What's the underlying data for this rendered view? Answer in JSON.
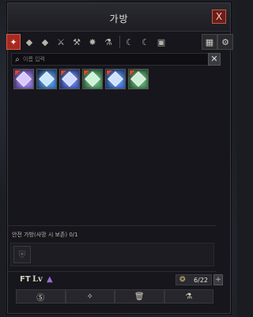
{
  "window": {
    "title": "가방",
    "close_label": "X"
  },
  "tabs": [
    {
      "name": "tab-all",
      "glyph": "✦",
      "active": true
    },
    {
      "name": "tab-equipment",
      "glyph": "◆",
      "active": false
    },
    {
      "name": "tab-accessory",
      "glyph": "◆",
      "active": false
    },
    {
      "name": "tab-weapon",
      "glyph": "⚔",
      "active": false
    },
    {
      "name": "tab-craft",
      "glyph": "⚒",
      "active": false
    },
    {
      "name": "tab-material",
      "glyph": "✸",
      "active": false
    },
    {
      "name": "tab-potion",
      "glyph": "⚗",
      "active": false
    },
    {
      "name": "tab-moon-1",
      "glyph": "☾",
      "active": false
    },
    {
      "name": "tab-moon-2",
      "glyph": "☾",
      "active": false
    },
    {
      "name": "tab-misc",
      "glyph": "▣",
      "active": false
    }
  ],
  "tab_right": [
    {
      "name": "grid-view-icon",
      "glyph": "▦"
    },
    {
      "name": "sort-icon",
      "glyph": "⚙"
    }
  ],
  "search": {
    "placeholder": "이름 입력",
    "value": "",
    "clear_label": "✕"
  },
  "items": [
    {
      "color_a": "#3b1e6b",
      "color_b": "#a68bff",
      "gem": "#d7c8ff",
      "new": true
    },
    {
      "color_a": "#16325e",
      "color_b": "#4ea0ff",
      "gem": "#cbe6ff",
      "new": false
    },
    {
      "color_a": "#1a2c63",
      "color_b": "#5b7dff",
      "gem": "#d0dbff",
      "new": true
    },
    {
      "color_a": "#1e4a2a",
      "color_b": "#5ec27a",
      "gem": "#cdf2d8",
      "new": true
    },
    {
      "color_a": "#17356a",
      "color_b": "#4f8dff",
      "gem": "#cfe1ff",
      "new": true
    },
    {
      "color_a": "#1d4a28",
      "color_b": "#59b56f",
      "gem": "#cdeed5",
      "new": true
    }
  ],
  "safe_bag": {
    "label": "안전 가방(사망 시 보존) 0/1",
    "slot_glyph": "⛨"
  },
  "footer": {
    "icon_ft": "FT",
    "icon_lv": "Lv",
    "icon_grade": "▲",
    "capacity": "6/22",
    "capacity_icon": "❂",
    "capacity_add": "+",
    "buttons": [
      {
        "name": "currency-button",
        "glyph": "Ⓢ"
      },
      {
        "name": "decompose-button",
        "glyph": "✧"
      },
      {
        "name": "trash-button",
        "glyph": "🗑"
      },
      {
        "name": "alchemy-button",
        "glyph": "⚗"
      }
    ]
  }
}
